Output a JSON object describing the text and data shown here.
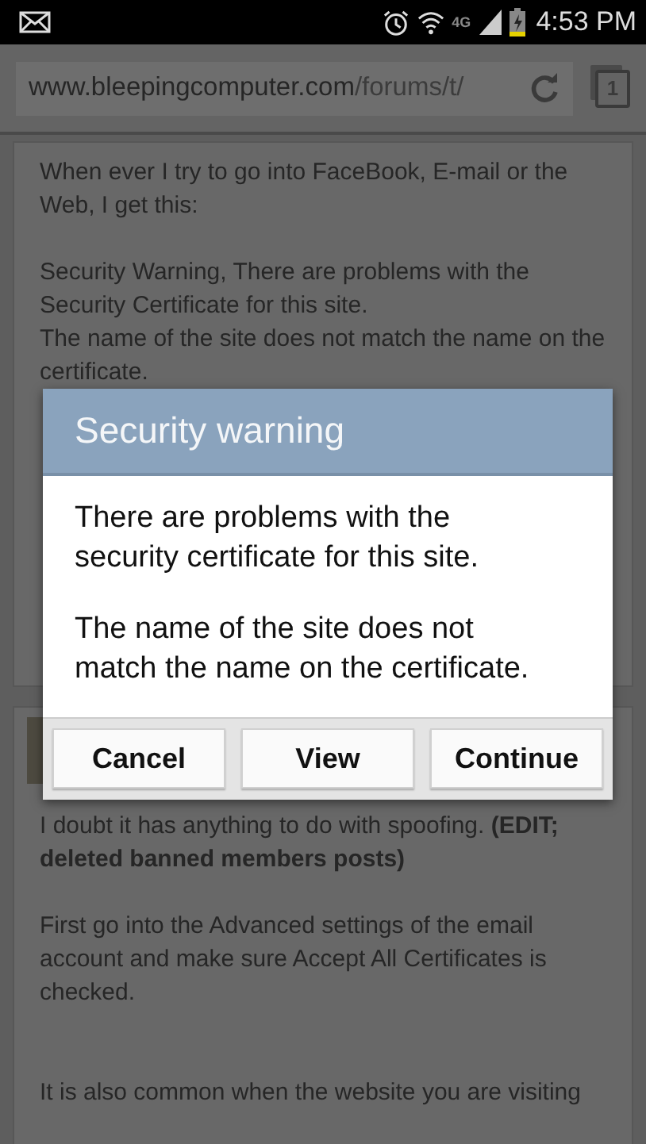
{
  "status_bar": {
    "network_type": "4G",
    "time": "4:53 PM"
  },
  "browser": {
    "url_host": "www.bleepingcomputer.com",
    "url_path": "/forums/t/",
    "tab_count": "1"
  },
  "posts": [
    {
      "paragraphs": [
        "When ever I try to go into FaceBook,  E-mail or the Web, I get this:",
        "Security Warning, There are problems with the Security Certificate for this site.\nThe name of the site does not match the name on the certificate."
      ]
    },
    {
      "paragraphs": [
        "I doubt it has anything to do with spoofing. **(EDIT; deleted banned members posts)**",
        "First go into the Advanced settings of the email account and make sure Accept All Certificates is checked.",
        "It is also common when the website you are visiting"
      ]
    }
  ],
  "dialog": {
    "title": "Security warning",
    "messages": [
      "There are problems with the security certificate for this site.",
      "The name of the site does not match the name on the certificate."
    ],
    "buttons": [
      "Cancel",
      "View",
      "Continue"
    ]
  }
}
